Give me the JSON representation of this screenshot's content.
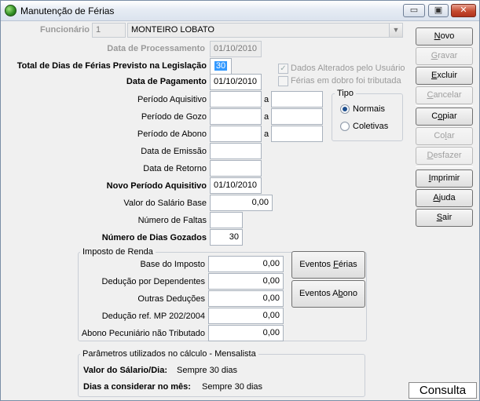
{
  "window": {
    "title": "Manutenção de Férias",
    "minimize_glyph": "▭",
    "restore_glyph": "▣",
    "close_glyph": "✕"
  },
  "form": {
    "funcionario": {
      "label": "Funcionário",
      "code": "1",
      "name": "MONTEIRO LOBATO"
    },
    "data_processamento": {
      "label": "Data de Processamento",
      "value": "01/10/2010"
    },
    "total_dias": {
      "label": "Total de Dias de Férias Previsto na Legislação",
      "value": "30"
    },
    "dados_alterados": {
      "label": "Dados Alterados pelo Usuário",
      "checked": true
    },
    "ferias_dobro": {
      "label": "Férias em dobro foi tributada",
      "checked": false
    },
    "data_pagamento": {
      "label": "Data de Pagamento",
      "value": "01/10/2010"
    },
    "periodo_aquisitivo": {
      "label": "Período Aquisitivo",
      "from": "",
      "sep": "a",
      "to": ""
    },
    "periodo_gozo": {
      "label": "Período de Gozo",
      "from": "",
      "sep": "a",
      "to": ""
    },
    "periodo_abono": {
      "label": "Período de Abono",
      "from": "",
      "sep": "a",
      "to": ""
    },
    "data_emissao": {
      "label": "Data de Emissão",
      "value": ""
    },
    "data_retorno": {
      "label": "Data de Retorno",
      "value": ""
    },
    "novo_periodo": {
      "label": "Novo Período Aquisitivo",
      "value": "01/10/2010"
    },
    "valor_salario_base": {
      "label": "Valor do Salário Base",
      "value": "0,00"
    },
    "numero_faltas": {
      "label": "Número de Faltas",
      "value": ""
    },
    "dias_gozados": {
      "label": "Número de Dias Gozados",
      "value": "30"
    },
    "tipo": {
      "title": "Tipo",
      "options": [
        "Normais",
        "Coletivas"
      ],
      "selected": "Normais"
    }
  },
  "imposto": {
    "title": "Imposto de Renda",
    "rows": [
      {
        "label": "Base do Imposto",
        "value": "0,00"
      },
      {
        "label": "Dedução por Dependentes",
        "value": "0,00"
      },
      {
        "label": "Outras Deduções",
        "value": "0,00"
      },
      {
        "label": "Dedução ref. MP 202/2004",
        "value": "0,00"
      },
      {
        "label": "Abono Pecuniário não Tributado",
        "value": "0,00"
      }
    ],
    "eventos_ferias": {
      "pre": "Eventos ",
      "u": "F",
      "post": "érias"
    },
    "eventos_abono": {
      "pre": "Eventos A",
      "u": "b",
      "post": "ono"
    }
  },
  "parametros": {
    "title": "Parâmetros utilizados no cálculo - Mensalista",
    "salario_dia_label": "Valor do Sálario/Dia:",
    "salario_dia_value": "Sempre 30 dias",
    "dias_mes_label": "Dias a considerar no mês:",
    "dias_mes_value": "Sempre 30 dias"
  },
  "buttons": {
    "novo": {
      "pre": "",
      "u": "N",
      "post": "ovo",
      "enabled": true
    },
    "gravar": {
      "pre": "",
      "u": "G",
      "post": "ravar",
      "enabled": false
    },
    "excluir": {
      "pre": "",
      "u": "E",
      "post": "xcluir",
      "enabled": true
    },
    "cancelar": {
      "pre": "",
      "u": "C",
      "post": "ancelar",
      "enabled": false
    },
    "copiar": {
      "pre": "C",
      "u": "o",
      "post": "piar",
      "enabled": true
    },
    "colar": {
      "pre": "Co",
      "u": "l",
      "post": "ar",
      "enabled": false
    },
    "desfazer": {
      "pre": "",
      "u": "D",
      "post": "esfazer",
      "enabled": false
    },
    "imprimir": {
      "pre": "",
      "u": "I",
      "post": "mprimir",
      "enabled": true
    },
    "ajuda": {
      "pre": "",
      "u": "A",
      "post": "juda",
      "enabled": true
    },
    "sair": {
      "pre": "",
      "u": "S",
      "post": "air",
      "enabled": true
    }
  },
  "status": {
    "mode": "Consulta"
  },
  "colors": {
    "selection": "#3399ff",
    "window_bg": "#f0f0f0",
    "close_button": "#c54a2f"
  }
}
